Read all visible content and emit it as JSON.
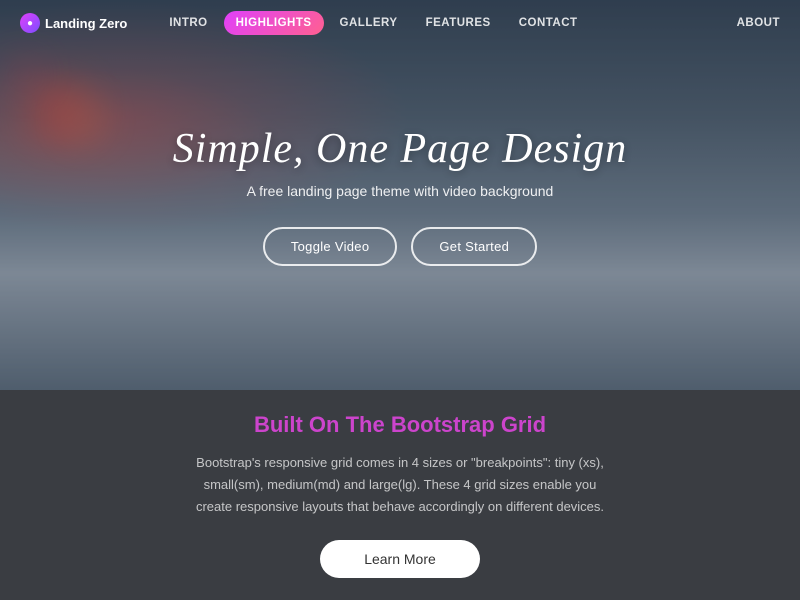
{
  "nav": {
    "brand": "Landing Zero",
    "links": [
      {
        "label": "INTRO",
        "active": false
      },
      {
        "label": "HIGHLIGHTS",
        "active": true
      },
      {
        "label": "GALLERY",
        "active": false
      },
      {
        "label": "FEATURES",
        "active": false
      },
      {
        "label": "CONTACT",
        "active": false
      }
    ],
    "right_link": "ABOUT"
  },
  "hero": {
    "title": "Simple, One Page Design",
    "subtitle": "A free landing page theme with video background",
    "toggle_video_label": "Toggle Video",
    "get_started_label": "Get Started"
  },
  "section2": {
    "title": "Built On The Bootstrap Grid",
    "body": "Bootstrap's responsive grid comes in 4 sizes or \"breakpoints\": tiny (xs), small(sm), medium(md) and large(lg). These 4 grid sizes enable you create responsive layouts that behave accordingly on different devices.",
    "learn_more_label": "Learn More"
  }
}
